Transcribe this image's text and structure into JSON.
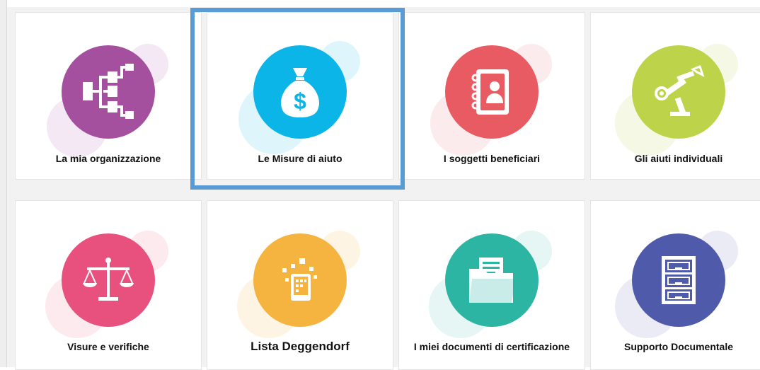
{
  "tiles": [
    {
      "label": "La mia organizzazione",
      "icon": "org-chart-icon",
      "color": "#a4509f"
    },
    {
      "label": "Le Misure di aiuto",
      "icon": "money-bag-icon",
      "color": "#0bb5e8",
      "selected": true
    },
    {
      "label": "I soggetti beneficiari",
      "icon": "address-book-icon",
      "color": "#e95b63"
    },
    {
      "label": "Gli aiuti individuali",
      "icon": "robot-arm-icon",
      "color": "#bcd34a"
    },
    {
      "label": "Visure e verifiche",
      "icon": "scales-icon",
      "color": "#e8507e"
    },
    {
      "label": "Lista Deggendorf",
      "icon": "tablet-icon",
      "color": "#f5b440"
    },
    {
      "label": "I miei documenti di certificazione",
      "icon": "folder-icon",
      "color": "#2db5a3"
    },
    {
      "label": "Supporto Documentale",
      "icon": "filing-cabinet-icon",
      "color": "#4f5aab"
    }
  ]
}
